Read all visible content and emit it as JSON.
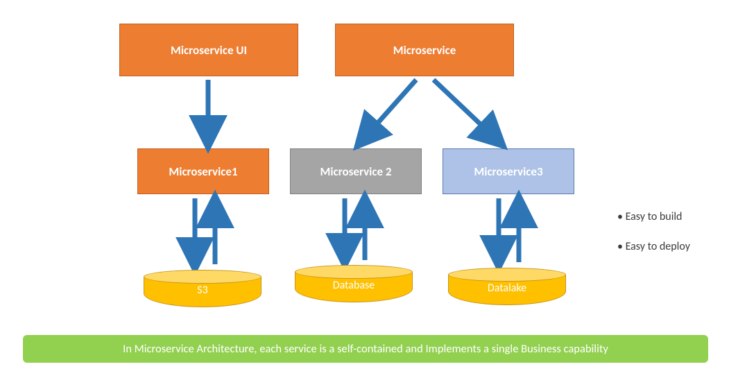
{
  "top_boxes": {
    "left": "Microservice UI",
    "right": "Microservice"
  },
  "mid_boxes": {
    "b1": "Microservice1",
    "b2": "Microservice 2",
    "b3": "Microservice3"
  },
  "stores": {
    "s1": "S3",
    "s2": "Database",
    "s3": "Datalake"
  },
  "bullets": {
    "b1": "Easy to build",
    "b2": "Easy to deploy"
  },
  "banner_text": "In Microservice Architecture, each service is a self-contained and Implements a single Business capability",
  "chart_data": {
    "type": "diagram",
    "nodes": [
      {
        "id": "ui",
        "label": "Microservice UI",
        "kind": "box",
        "color": "orange"
      },
      {
        "id": "ms",
        "label": "Microservice",
        "kind": "box",
        "color": "orange"
      },
      {
        "id": "ms1",
        "label": "Microservice1",
        "kind": "box",
        "color": "orange"
      },
      {
        "id": "ms2",
        "label": "Microservice 2",
        "kind": "box",
        "color": "grey"
      },
      {
        "id": "ms3",
        "label": "Microservice3",
        "kind": "box",
        "color": "blue"
      },
      {
        "id": "s3",
        "label": "S3",
        "kind": "cylinder",
        "color": "yellow"
      },
      {
        "id": "db",
        "label": "Database",
        "kind": "cylinder",
        "color": "yellow"
      },
      {
        "id": "dl",
        "label": "Datalake",
        "kind": "cylinder",
        "color": "yellow"
      }
    ],
    "edges": [
      {
        "from": "ui",
        "to": "ms1",
        "bidirectional": false
      },
      {
        "from": "ms",
        "to": "ms2",
        "bidirectional": false
      },
      {
        "from": "ms",
        "to": "ms3",
        "bidirectional": false
      },
      {
        "from": "ms1",
        "to": "s3",
        "bidirectional": true
      },
      {
        "from": "ms2",
        "to": "db",
        "bidirectional": true
      },
      {
        "from": "ms3",
        "to": "dl",
        "bidirectional": true
      }
    ],
    "annotations": [
      "Easy to build",
      "Easy to deploy"
    ],
    "caption": "In Microservice Architecture, each service is a self-contained and Implements a single Business capability"
  }
}
